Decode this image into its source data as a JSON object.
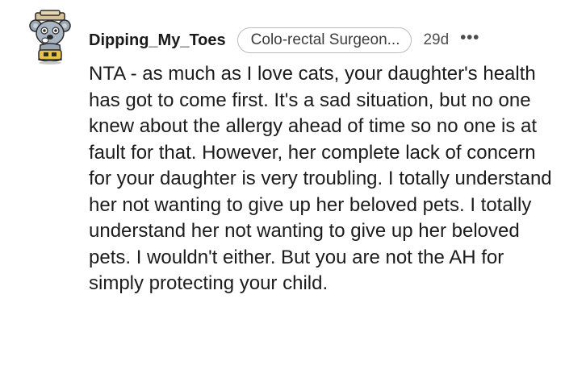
{
  "comment": {
    "username": "Dipping_My_Toes",
    "flair": "Colo-rectal Surgeon...",
    "timestamp": "29d",
    "more_label": "•••",
    "body": "NTA - as much as I love cats, your daughter's health has got to come first. It's a sad situation, but no one knew about the allergy ahead of time so no one is at fault for that. However, her complete lack of concern for your daughter is very troubling. I totally understand her not wanting to give up her beloved pets. I totally understand her not wanting to give up her beloved pets. I wouldn't either. But you are not the AH for simply protecting your child.",
    "avatar_icon": "snoo-avatar-icon"
  },
  "colors": {
    "text": "#1a1a1b",
    "meta": "#4d4d4d",
    "flair_border": "#b9bcbf",
    "avatar_body": "#9aa7b3",
    "avatar_accent": "#e8c34a"
  }
}
